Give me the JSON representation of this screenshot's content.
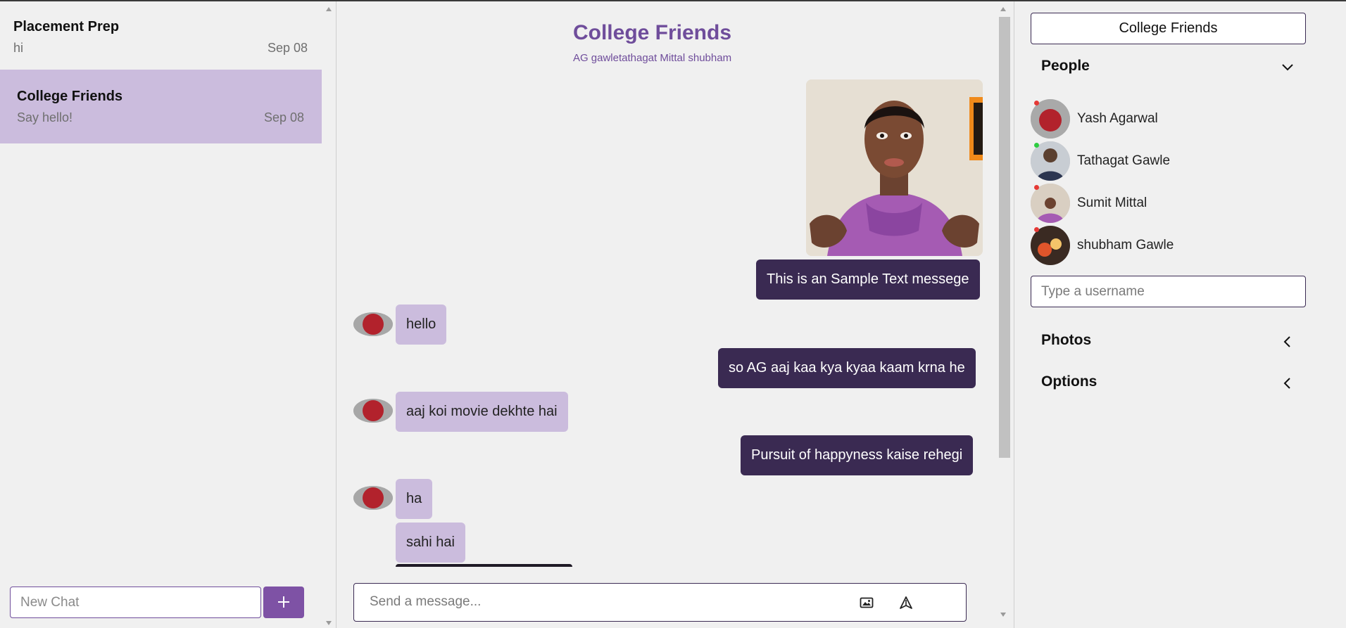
{
  "chat_list": [
    {
      "title": "Placement Prep",
      "preview": "hi",
      "date": "Sep 08",
      "active": false
    },
    {
      "title": "College Friends",
      "preview": "Say hello!",
      "date": "Sep 08",
      "active": true
    }
  ],
  "new_chat": {
    "placeholder": "New Chat",
    "add_icon": "plus-icon"
  },
  "chat": {
    "title": "College Friends",
    "members_line": "AG gawletathagat Mittal shubham",
    "messages": [
      {
        "direction": "out",
        "type": "image",
        "alt": "cartoon-avatar-image"
      },
      {
        "direction": "out",
        "type": "text",
        "text": "This is an Sample Text messege"
      },
      {
        "direction": "in",
        "type": "text",
        "text": "hello"
      },
      {
        "direction": "out",
        "type": "text",
        "text": "so AG aaj kaa kya kyaa kaam krna he"
      },
      {
        "direction": "in",
        "type": "text",
        "text": "aaj koi movie dekhte hai"
      },
      {
        "direction": "out",
        "type": "text",
        "text": "Pursuit of happyness kaise rehegi"
      },
      {
        "direction": "in",
        "type": "text",
        "text": "ha"
      },
      {
        "direction": "in",
        "type": "text",
        "text": "sahi hai"
      }
    ],
    "message_input": {
      "placeholder": "Send a message..."
    },
    "icons": {
      "attach_image": "image-icon",
      "send": "send-icon"
    }
  },
  "details": {
    "group_name": "College Friends",
    "people_section": {
      "label": "People",
      "expanded": true
    },
    "people": [
      {
        "name": "Yash Agarwal",
        "online": false
      },
      {
        "name": "Tathagat Gawle",
        "online": true
      },
      {
        "name": "Sumit Mittal",
        "online": false
      },
      {
        "name": "shubham Gawle",
        "online": false
      }
    ],
    "username_placeholder": "Type a username",
    "photos_section": {
      "label": "Photos",
      "expanded": false
    },
    "options_section": {
      "label": "Options",
      "expanded": false
    }
  },
  "colors": {
    "accent": "#6f4d9b",
    "button": "#7e52a5",
    "outgoing_bubble": "#3a2a52",
    "incoming_bubble": "#cbbcdd",
    "online": "#2ecc40",
    "offline": "#e53935"
  }
}
